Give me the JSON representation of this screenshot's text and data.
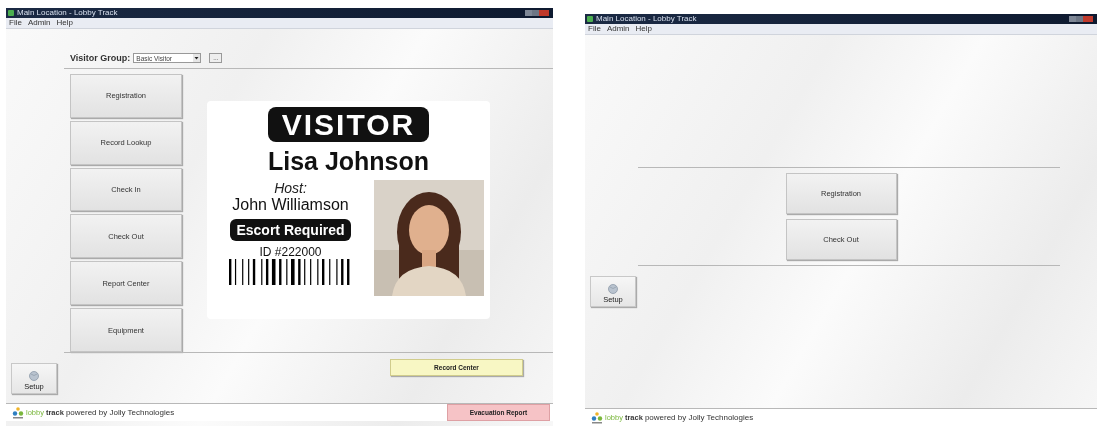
{
  "windows": [
    {
      "title": "Main Location - Lobby Track",
      "menu": [
        "File",
        "Admin",
        "Help"
      ],
      "visitor_group": {
        "label": "Visitor Group:",
        "value": "Basic Visitor",
        "button": "..."
      },
      "actions": [
        "Registration",
        "Record Lookup",
        "Check In",
        "Check Out",
        "Report Center",
        "Equipment"
      ],
      "badge": {
        "heading": "VISITOR",
        "name": "Lisa Johnson",
        "host_label": "Host:",
        "host": "John Williamson",
        "notice": "Escort Required",
        "id": "ID #222000"
      },
      "record_button": "Record Center",
      "setup": "Setup",
      "footer": {
        "brand_first": "lobby",
        "brand_second": "track",
        "tagline": "powered by Jolly Technologies",
        "alert_button": "Evacuation Report"
      }
    },
    {
      "title": "Main Location - Lobby Track",
      "menu": [
        "File",
        "Admin",
        "Help"
      ],
      "actions": [
        "Registration",
        "Check Out"
      ],
      "setup": "Setup",
      "footer": {
        "brand_first": "lobby",
        "brand_second": "track",
        "tagline": "powered by Jolly Technologies"
      }
    }
  ]
}
